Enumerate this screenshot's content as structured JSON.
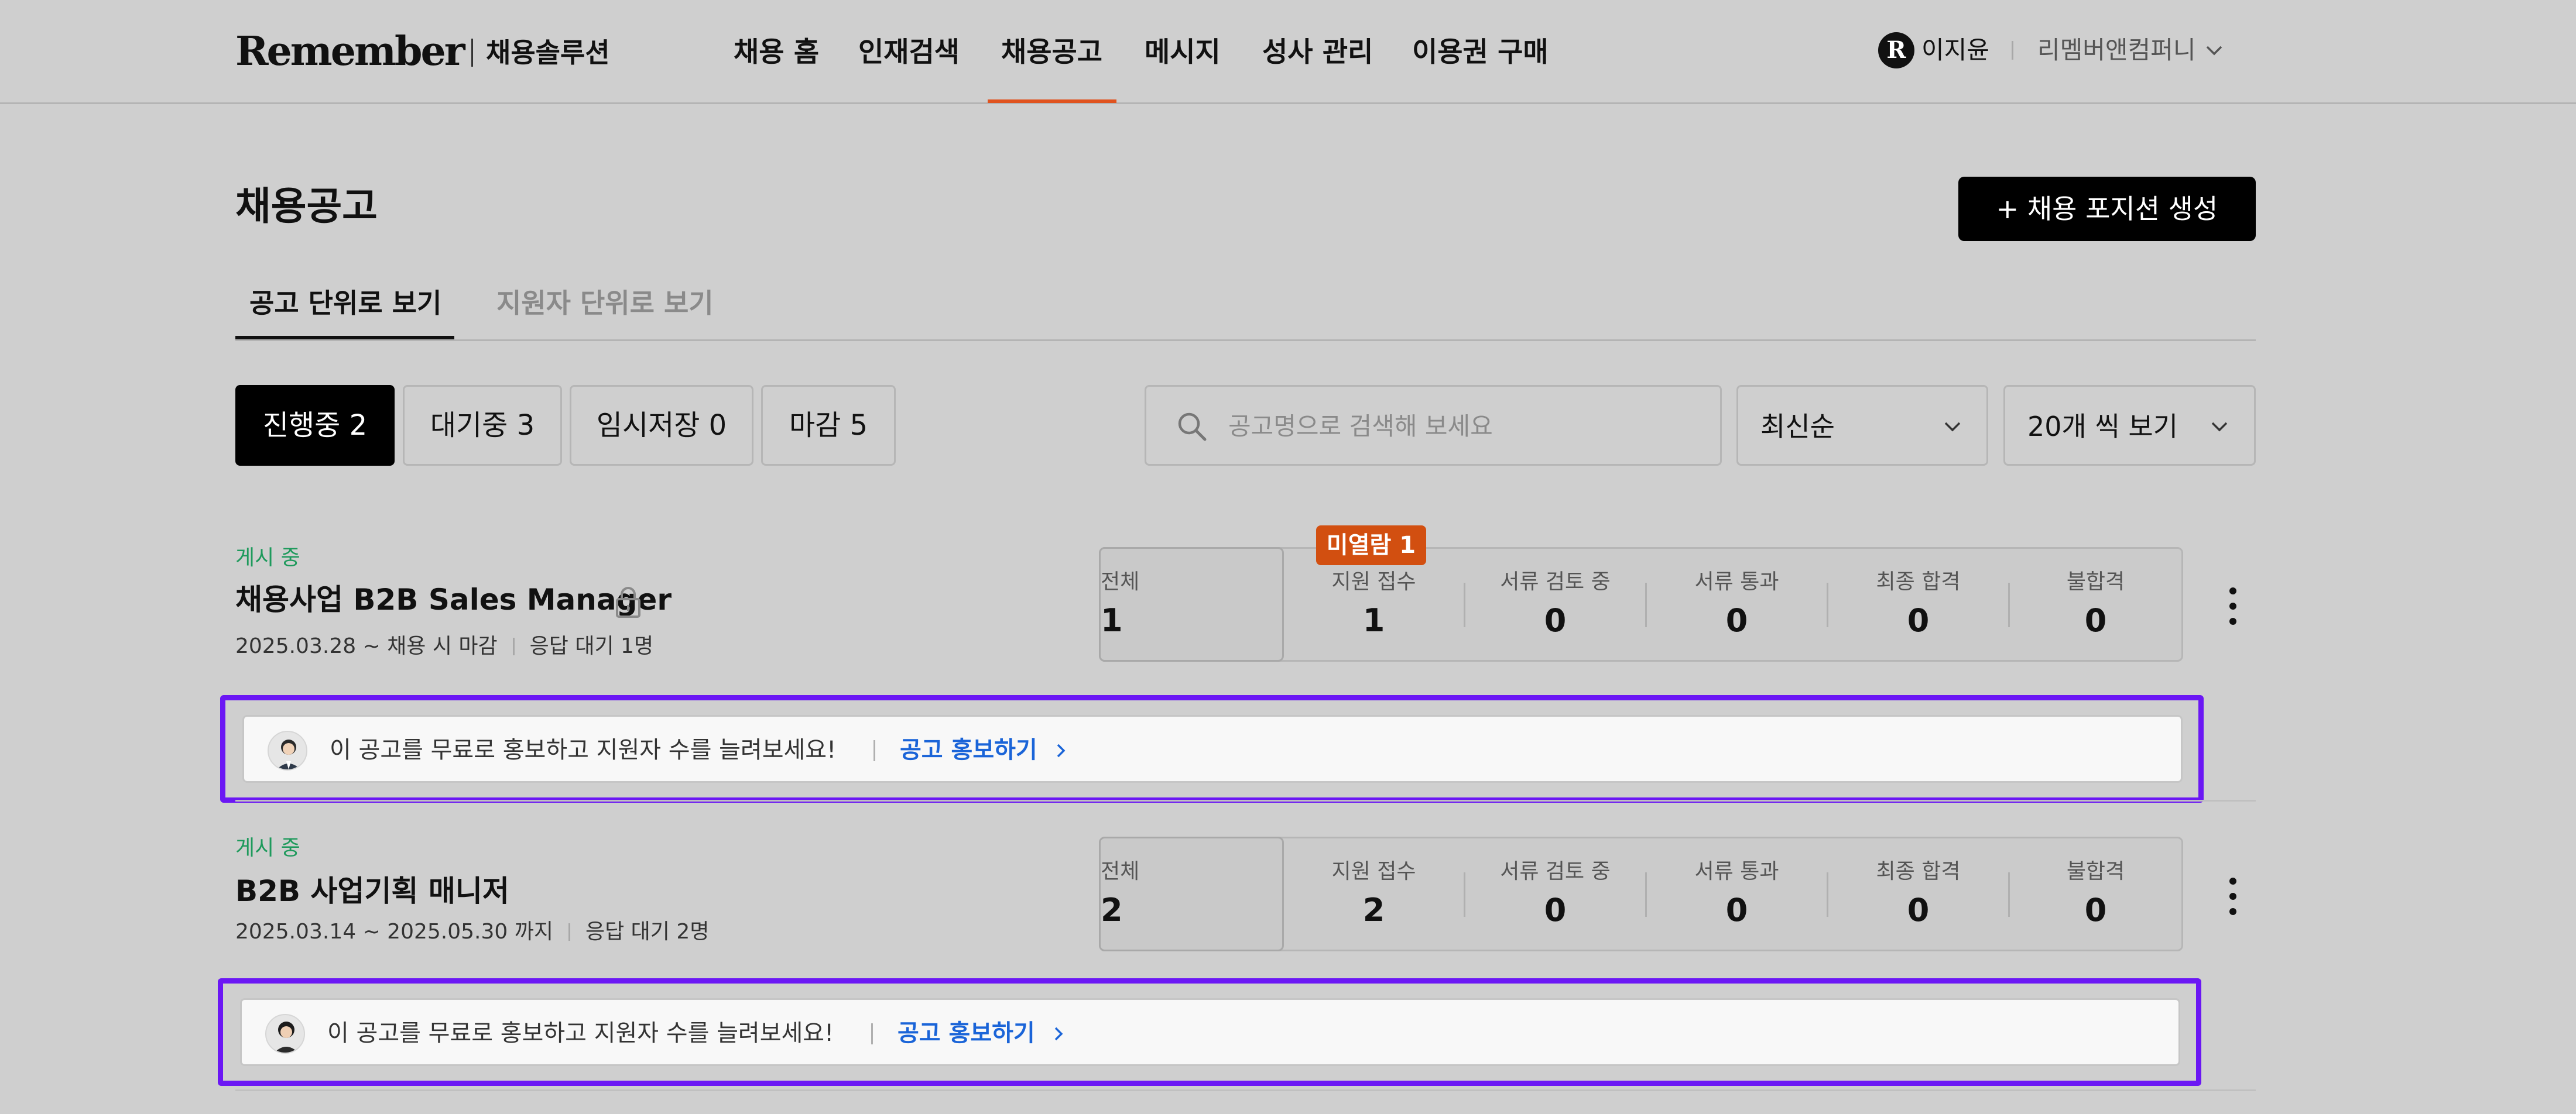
{
  "header": {
    "logo": "Remember",
    "logo_sub": "채용솔루션",
    "nav": [
      "채용 홈",
      "인재검색",
      "채용공고",
      "메시지",
      "성사 관리",
      "이용권 구매"
    ],
    "active_nav": "채용공고",
    "user_initial": "R",
    "user_name": "이지윤",
    "company": "리멤버앤컴퍼니"
  },
  "page": {
    "title": "채용공고",
    "create_button": "+ 채용 포지션 생성",
    "tabs": [
      "공고 단위로 보기",
      "지원자 단위로 보기"
    ]
  },
  "filters": {
    "chips": [
      "진행중 2",
      "대기중 3",
      "임시저장 0",
      "마감 5"
    ],
    "search_placeholder": "공고명으로 검색해 보세요",
    "sort_label": "최신순",
    "page_size_label": "20개 씩 보기"
  },
  "stat_labels": [
    "전체",
    "지원 접수",
    "서류 검토 중",
    "서류 통과",
    "최종 합격",
    "불합격"
  ],
  "jobs": [
    {
      "status": "게시 중",
      "title": "채용사업 B2B Sales Manager",
      "period": "2025.03.28 ~ 채용 시 마감",
      "pending": "응답 대기 1명",
      "stats": [
        "1",
        "1",
        "0",
        "0",
        "0",
        "0"
      ],
      "badge": "미열람 1",
      "promo_text": "이 공고를 무료로 홍보하고 지원자 수를 늘려보세요!",
      "promo_link": "공고 홍보하기"
    },
    {
      "status": "게시 중",
      "title": "B2B 사업기획 매니저",
      "period": "2025.03.14 ~ 2025.05.30 까지",
      "pending": "응답 대기 2명",
      "stats": [
        "2",
        "2",
        "0",
        "0",
        "0",
        "0"
      ],
      "promo_text": "이 공고를 무료로 홍보하고 지원자 수를 늘려보세요!",
      "promo_link": "공고 홍보하기"
    }
  ],
  "colors": {
    "background": "#cfcfcf",
    "accent_nav": "#e0531f",
    "status_green": "#1e9a5c",
    "badge_orange": "#d24f10",
    "link_blue": "#1a64d8",
    "highlight_purple": "#6b17f4"
  }
}
